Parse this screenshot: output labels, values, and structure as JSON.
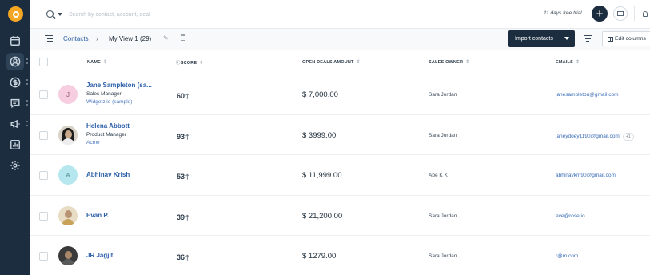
{
  "topbar": {
    "search_placeholder": "Search by contact, account, deal",
    "trial_text": "11 days free trial",
    "add_label": "+"
  },
  "toolbar": {
    "breadcrumb_root": "Contacts",
    "breadcrumb_sep": "›",
    "view_name": "My View 1 (29)",
    "import_label": "Import contacts",
    "edit_columns_label": "Edit columns"
  },
  "table": {
    "headers": {
      "name": "NAME",
      "score": "SCORE",
      "amount": "OPEN DEALS AMOUNT",
      "owner": "SALES OWNER",
      "emails": "EMAILS"
    },
    "rows": [
      {
        "initial": "J",
        "name": "Jane Sampleton (sa...",
        "job": "Sales Manager",
        "company": "Widgetz.io (sample)",
        "score": "60",
        "amount": "$ 7,000.00",
        "owner": "Sara Jordan",
        "email": "janesampleton@gmail.com",
        "extra": ""
      },
      {
        "initial": "",
        "name": "Helena Abbott",
        "job": "Product Manager",
        "company": "Acme",
        "score": "93",
        "amount": "$ 3999.00",
        "owner": "Sara Jordan",
        "email": "janeydoey1190@gmail.com",
        "extra": "+1"
      },
      {
        "initial": "A",
        "name": "Abhinav Krish",
        "job": "",
        "company": "",
        "score": "53",
        "amount": "$ 11,999.00",
        "owner": "Abe K K",
        "email": "abhinavkm90@gmail.com",
        "extra": ""
      },
      {
        "initial": "",
        "name": "Evan P.",
        "job": "",
        "company": "",
        "score": "39",
        "amount": "$ 21,200.00",
        "owner": "Sara Jordan",
        "email": "eve@rose.io",
        "extra": ""
      },
      {
        "initial": "",
        "name": "JR Jagjit",
        "job": "",
        "company": "",
        "score": "36",
        "amount": "$ 1279.00",
        "owner": "Sara Jordan",
        "email": "r@m.com",
        "extra": ""
      }
    ]
  },
  "colors": {
    "sidebar": "#1b2d3f",
    "link": "#2c5fa8",
    "brand": "#f5a623"
  }
}
